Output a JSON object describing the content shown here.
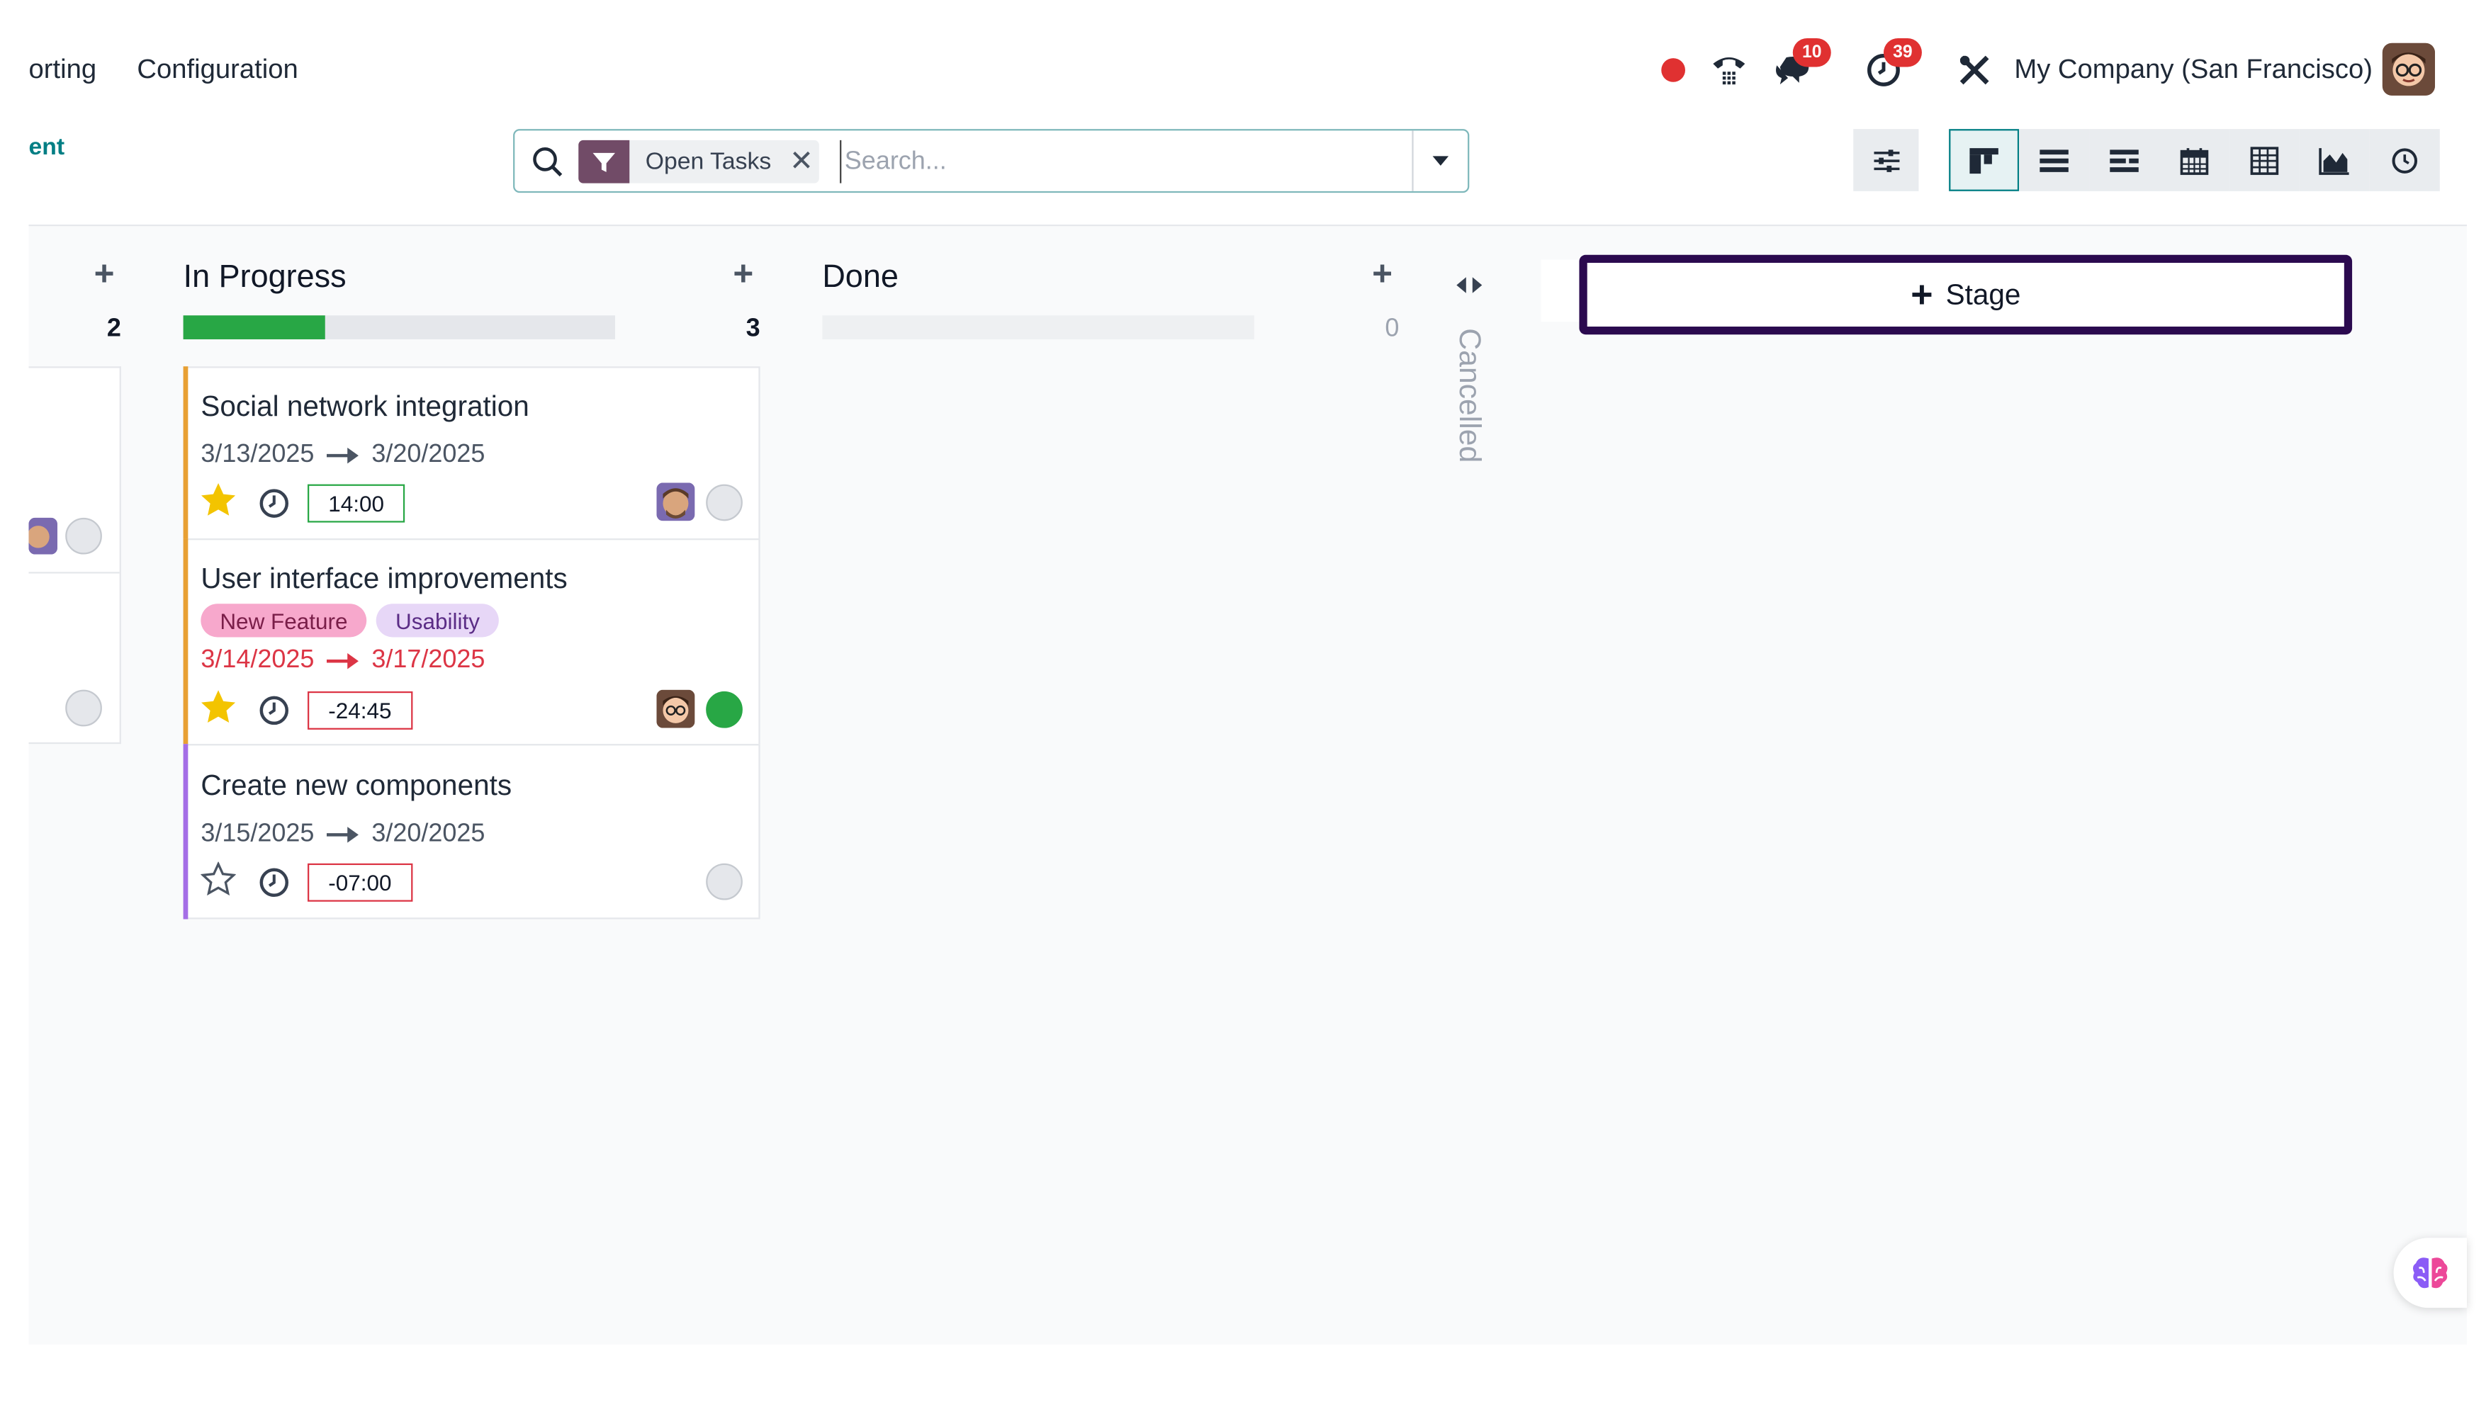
{
  "nav": {
    "reporting_label": "orting",
    "configuration_label": "Configuration",
    "messages_badge": "10",
    "activities_badge": "39",
    "company_name": "My Company (San Francisco)"
  },
  "breadcrumb": {
    "label": "ent"
  },
  "search": {
    "facet_label": "Open Tasks",
    "placeholder": "Search..."
  },
  "kanban": {
    "columns": [
      {
        "title": "",
        "count": "2"
      },
      {
        "title": "In Progress",
        "count": "3",
        "progress": 0.33
      },
      {
        "title": "Done",
        "count": "0",
        "progress": 0
      },
      {
        "title": "Cancelled"
      }
    ],
    "cards": [
      {
        "title": "Social network integration",
        "start": "3/13/2025",
        "end": "3/20/2025",
        "starred": true,
        "time": "14:00",
        "accent": "#e8a033",
        "time_border": "#28a745",
        "overdue": false,
        "state": "normal"
      },
      {
        "title": "User interface improvements",
        "tags": [
          {
            "label": "New Feature",
            "bg": "#f7a8cc",
            "fg": "#7a1e49"
          },
          {
            "label": "Usability",
            "bg": "#e7d7f7",
            "fg": "#5b2d86"
          }
        ],
        "start": "3/14/2025",
        "end": "3/17/2025",
        "starred": true,
        "time": "-24:45",
        "accent": "#e8a033",
        "time_border": "#dc3545",
        "overdue": true,
        "state": "done"
      },
      {
        "title": "Create new components",
        "start": "3/15/2025",
        "end": "3/20/2025",
        "starred": false,
        "time": "-07:00",
        "accent": "#a56ee6",
        "time_border": "#dc3545",
        "overdue": false,
        "state": "normal"
      }
    ],
    "add_stage_label": "Stage"
  },
  "colors": {
    "brand": "#714b67",
    "accent": "#017e84",
    "danger": "#e03131",
    "success": "#28a745",
    "stage_highlight": "#2b0a4f"
  },
  "icons": {
    "recording": "red-dot-icon",
    "phone": "phone-icon",
    "messages": "chat-icon",
    "activities": "clock-icon",
    "debug": "tools-icon",
    "search": "search-icon",
    "filter": "filter-icon",
    "ai": "brain-icon"
  }
}
